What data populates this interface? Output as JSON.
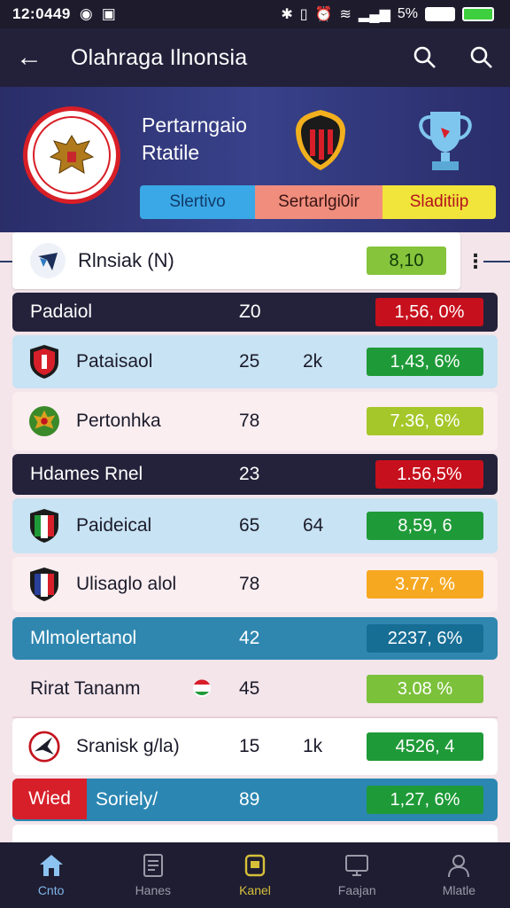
{
  "status": {
    "time": "12:0449",
    "battery": "5%"
  },
  "appbar": {
    "title": "Olahraga Ilnonsia"
  },
  "hero": {
    "title_line1": "Pertarngaio",
    "title_line2": "Rtatile",
    "segments": [
      "Slertivo",
      "Sertarlgi0ir",
      "Sladitiip"
    ]
  },
  "search_row": {
    "label": "Rlnsiak (N)",
    "value": "8,10"
  },
  "rows": [
    {
      "name": "Padaiol",
      "n1": "Z0",
      "n2": "",
      "value": "1,56, 0%"
    },
    {
      "name": "Pataisaol",
      "n1": "25",
      "n2": "2k",
      "value": "1,43, 6%"
    },
    {
      "name": "Pertonhka",
      "n1": "78",
      "n2": "",
      "value": "7.36, 6%"
    },
    {
      "name": "Hdames Rnel",
      "n1": "23",
      "n2": "",
      "value": "1.56,5%"
    },
    {
      "name": "Paideical",
      "n1": "65",
      "n2": "64",
      "value": "8,59, 6"
    },
    {
      "name": "Ulisaglo alol",
      "n1": "78",
      "n2": "",
      "value": "3.77, %"
    },
    {
      "name": "Mlmolertanol",
      "n1": "42",
      "n2": "",
      "value": "2237, 6%"
    },
    {
      "name": "Rirat Tananm",
      "n1": "45",
      "n2": "",
      "value": "3.08 %"
    },
    {
      "name": "Sranisk g/la)",
      "n1": "15",
      "n2": "1k",
      "value": "4526, 4"
    },
    {
      "name": "Soriely/",
      "tag": "Wied",
      "n1": "89",
      "n2": "",
      "value": "1,27, 6%"
    }
  ],
  "bottom_nav": [
    "Cnto",
    "Hanes",
    "Kanel",
    "Faajan",
    "Mlatle"
  ],
  "colors": {
    "red": "#d71f2a",
    "green": "#1f9a38",
    "lime": "#86c43c",
    "amber": "#f6a821",
    "teal": "#1e7fa6"
  }
}
